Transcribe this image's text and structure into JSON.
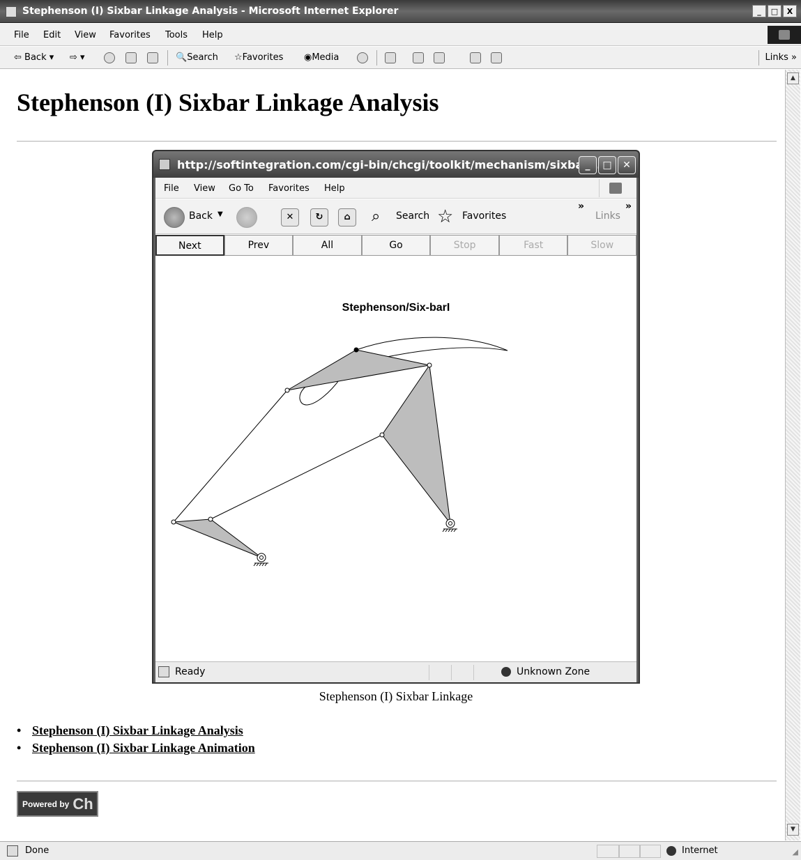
{
  "window": {
    "title": "Stephenson (I) Sixbar Linkage Analysis - Microsoft Internet Explorer",
    "controls": [
      "_",
      "□",
      "X"
    ]
  },
  "menubar": [
    "File",
    "Edit",
    "View",
    "Favorites",
    "Tools",
    "Help"
  ],
  "toolbar": {
    "back": "Back",
    "search": "Search",
    "favorites": "Favorites",
    "media": "Media",
    "links": "Links »"
  },
  "page": {
    "title": "Stephenson (I) Sixbar Linkage Analysis",
    "caption": "Stephenson (I) Sixbar Linkage",
    "links": [
      "Stephenson (I) Sixbar Linkage Analysis",
      "Stephenson (I) Sixbar Linkage Animation"
    ],
    "powered_by": "Powered by",
    "powered_logo": "Ch"
  },
  "inner_window": {
    "title": "http://softintegration.com/cgi-bin/chcgi/toolkit/mechanism/sixbar/...",
    "menubar": [
      "File",
      "View",
      "Go To",
      "Favorites",
      "Help"
    ],
    "toolbar": {
      "back": "Back",
      "search": "Search",
      "favorites": "Favorites",
      "links": "Links",
      "chevron": "»"
    },
    "controls": [
      "Next",
      "Prev",
      "All",
      "Go",
      "Stop",
      "Fast",
      "Slow"
    ],
    "plot_title": "Stephenson/Six-barI",
    "status": {
      "text": "Ready",
      "zone": "Unknown Zone"
    }
  },
  "statusbar": {
    "text": "Done",
    "zone": "Internet"
  },
  "colors": {
    "link_fill": "#bdbdbd",
    "titlebar": "#4a4a4a"
  }
}
